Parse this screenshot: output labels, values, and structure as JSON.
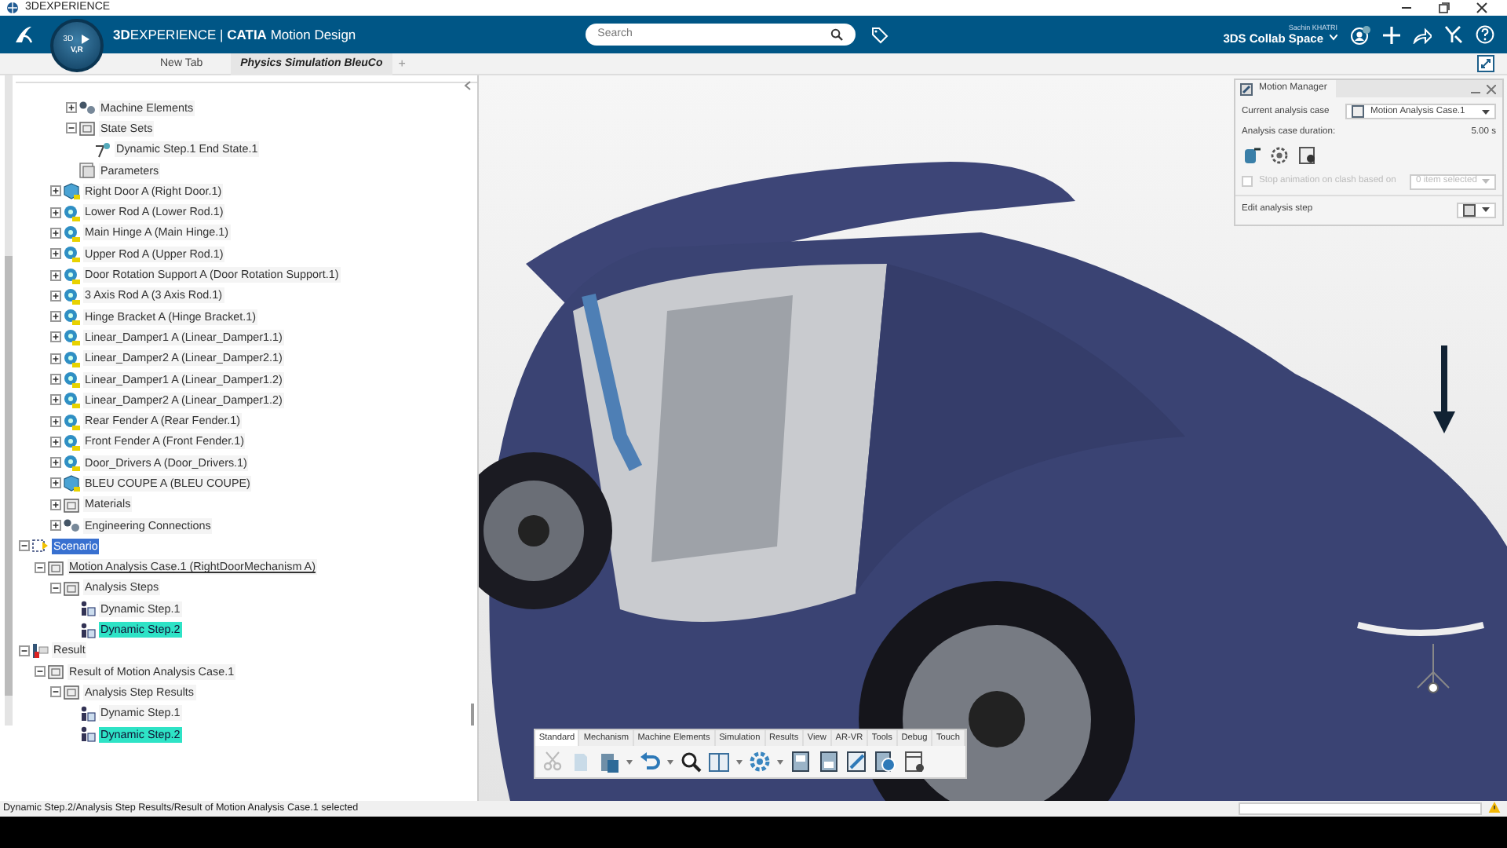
{
  "title_bar": {
    "title": "3DEXPERIENCE"
  },
  "top_bar": {
    "compass_top": "3D",
    "compass_bottom": "V,R",
    "brand": "**3D**EXPERIENCE | **CATIA** Motion Design",
    "search": {
      "placeholder": "Search"
    },
    "user": "Sachin KHATRI",
    "space": "3DS Collab Space"
  },
  "tabs": [
    {
      "label": "New Tab",
      "selected": false
    },
    {
      "label": "Physics Simulation BleuCo",
      "selected": true
    }
  ],
  "new_tab_button": "+",
  "tree": [
    {
      "children": [
        {
          "children": [
            {
              "children": [
                {
                  "label": "Machine Elements",
                  "kind": "machine",
                  "expanded": false,
                  "selected": false
                },
                {
                  "label": "State Sets",
                  "kind": "folder",
                  "expanded": true,
                  "selected": false,
                  "children": [
                    {
                      "label": "Dynamic Step.1 End State.1",
                      "kind": "state",
                      "selected": false
                    }
                  ]
                },
                {
                  "label": "Parameters",
                  "kind": "params",
                  "selected": false
                }
              ]
            },
            {
              "label": "Right Door A (Right Door.1)",
              "kind": "product",
              "expanded": false,
              "selected": false
            },
            {
              "label": "Lower Rod A (Lower Rod.1)",
              "kind": "part",
              "expanded": false,
              "selected": false
            },
            {
              "label": "Main Hinge A (Main Hinge.1)",
              "kind": "part",
              "expanded": false,
              "selected": false
            },
            {
              "label": "Upper Rod A (Upper Rod.1)",
              "kind": "part",
              "expanded": false,
              "selected": false
            },
            {
              "label": "Door Rotation Support A (Door Rotation Support.1)",
              "kind": "part",
              "expanded": false,
              "selected": false
            },
            {
              "label": "3 Axis Rod A (3 Axis Rod.1)",
              "kind": "part",
              "expanded": false,
              "selected": false
            },
            {
              "label": "Hinge Bracket A (Hinge Bracket.1)",
              "kind": "part",
              "expanded": false,
              "selected": false
            },
            {
              "label": "Linear_Damper1 A (Linear_Damper1.1)",
              "kind": "part",
              "expanded": false,
              "selected": false
            },
            {
              "label": "Linear_Damper2 A (Linear_Damper2.1)",
              "kind": "part",
              "expanded": false,
              "selected": false
            },
            {
              "label": "Linear_Damper1 A (Linear_Damper1.2)",
              "kind": "part",
              "expanded": false,
              "selected": false
            },
            {
              "label": "Linear_Damper2 A (Linear_Damper1.2)",
              "kind": "part",
              "expanded": false,
              "selected": false
            },
            {
              "label": "Rear Fender A (Rear Fender.1)",
              "kind": "part",
              "expanded": false,
              "selected": false
            },
            {
              "label": "Front Fender A (Front Fender.1)",
              "kind": "part",
              "expanded": false,
              "selected": false
            },
            {
              "label": "Door_Drivers A (Door_Drivers.1)",
              "kind": "part",
              "expanded": false,
              "selected": false
            },
            {
              "label": "BLEU COUPE A (BLEU COUPE)",
              "kind": "product",
              "expanded": false,
              "selected": false
            },
            {
              "label": "Materials",
              "kind": "folder",
              "expanded": false,
              "selected": false
            },
            {
              "label": "Engineering Connections",
              "kind": "machine",
              "expanded": false,
              "selected": false
            }
          ]
        }
      ]
    },
    {
      "label": "Scenario",
      "kind": "scenario",
      "expanded": true,
      "selected": false,
      "current": true,
      "children": [
        {
          "label": "Motion Analysis Case.1 (RightDoorMechanism A)",
          "kind": "folder",
          "expanded": true,
          "selected": false,
          "underlined": true,
          "children": [
            {
              "label": "Analysis Steps",
              "kind": "folder",
              "expanded": true,
              "selected": false,
              "children": [
                {
                  "label": "Dynamic Step.1",
                  "kind": "step",
                  "selected": false
                },
                {
                  "label": "Dynamic Step.2",
                  "kind": "step",
                  "selected": true
                }
              ]
            }
          ]
        }
      ]
    },
    {
      "label": "Result",
      "kind": "result",
      "expanded": true,
      "selected": false,
      "children": [
        {
          "label": "Result of Motion Analysis Case.1",
          "kind": "folder",
          "expanded": true,
          "selected": false,
          "children": [
            {
              "label": "Analysis Step Results",
              "kind": "folder",
              "expanded": true,
              "selected": false,
              "children": [
                {
                  "label": "Dynamic Step.1",
                  "kind": "step",
                  "selected": false
                },
                {
                  "label": "Dynamic Step.2",
                  "kind": "step",
                  "selected": true
                }
              ]
            }
          ]
        }
      ]
    }
  ],
  "motion_manager": {
    "title": "Motion Manager",
    "case_label": "Current analysis case",
    "case_value": "Motion Analysis Case.1",
    "duration_label": "Analysis case duration:",
    "duration_value": "5.00 s",
    "clash": {
      "label": "Stop animation on clash based on",
      "checked": false,
      "disabled": true
    },
    "clash_select": "0 item selected",
    "edit_label": "Edit analysis step"
  },
  "toolbar_tabs": [
    {
      "label": "Standard",
      "selected": true
    },
    {
      "label": "Mechanism",
      "selected": false
    },
    {
      "label": "Machine Elements",
      "selected": false
    },
    {
      "label": "Simulation",
      "selected": false
    },
    {
      "label": "Results",
      "selected": false
    },
    {
      "label": "View",
      "selected": false
    },
    {
      "label": "AR-VR",
      "selected": false
    },
    {
      "label": "Tools",
      "selected": false
    },
    {
      "label": "Debug",
      "selected": false
    },
    {
      "label": "Touch",
      "selected": false
    }
  ],
  "status_bar": {
    "text": "Dynamic Step.2/Analysis Step Results/Result of Motion Analysis Case.1 selected"
  }
}
